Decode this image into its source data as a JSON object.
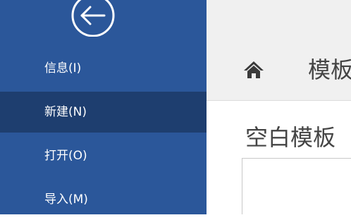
{
  "sidebar": {
    "background_color": "#2b579a",
    "selected_color": "#1e3e6f",
    "back_icon": "arrow-left-circle-icon",
    "items": [
      {
        "label": "信息(I)"
      },
      {
        "label": "新建(N)",
        "selected": true
      },
      {
        "label": "打开(O)"
      },
      {
        "label": "导入(M)"
      }
    ]
  },
  "main": {
    "breadcrumb": {
      "icon": "home-icon",
      "title": "模板"
    },
    "section_title": "空白模板"
  }
}
